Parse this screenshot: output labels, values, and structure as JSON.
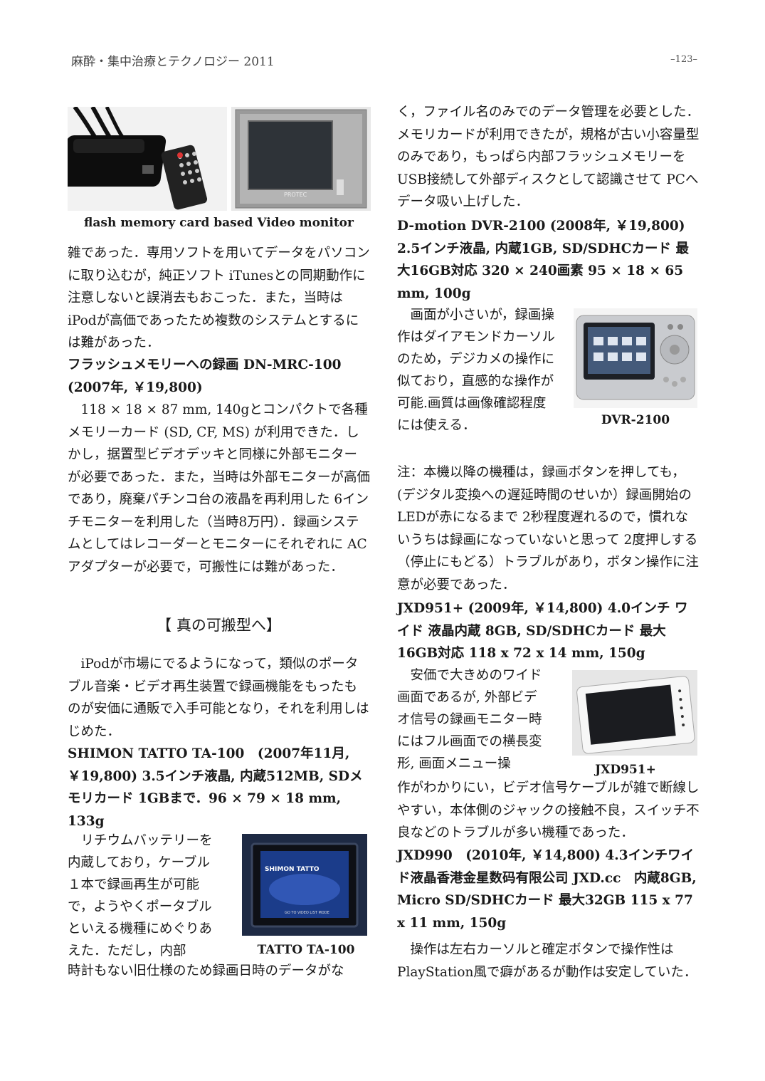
{
  "header": {
    "journal": "麻酔・集中治療とテクノロジー 2011",
    "page": "–123–"
  },
  "left": {
    "fig1_caption": "flash memory card based Video monitor",
    "fig1_label": "PROTEC",
    "p1": "雑であった．専用ソフトを用いてデータをパソコンに取り込むが，純正ソフト iTunesとの同期動作に注意しないと誤消去もおこった．また，当時は iPodが高価であったため複数のシステムとするには難があった．",
    "h_dnmrc": "フラッシュメモリーへの録画 DN-MRC-100 (2007年,  ￥19,800)",
    "p2": "118 × 18 × 87 mm, 140gとコンパクトで各種メモリーカード (SD, CF, MS) が利用できた．しかし，据置型ビデオデッキと同様に外部モニターが必要であった．また，当時は外部モニターが高価であり，廃棄パチンコ台の液晶を再利用した 6インチモニターを利用した（当時8万円）．録画システムとしてはレコーダーとモニターにそれぞれに ACアダプターが必要で，可搬性には難があった．",
    "section": "【 真の可搬型へ】",
    "p3": "iPodが市場にでるようになって，類似のポータブル音楽・ビデオ再生装置で録画機能をもったものが安価に通販で入手可能となり，それを利用しはじめた．",
    "h_tatto": "SHIMON TATTO TA-100　(2007年11月,  ￥19,800) 3.5インチ液晶,  内蔵512MB,  SDメモリカード 1GBまで．96 × 79 × 18 mm, 133g",
    "p4_narrow": "リチウムバッテリーを内蔵しており，ケーブル１本で録画再生が可能で，ようやくポータブルといえる機種にめぐりあえた．ただし，内部",
    "p4_full": "時計もない旧仕様のため録画日時のデータがな",
    "tatto_caption": "TATTO TA-100",
    "tatto_screen_brand": "SHIMON TATTO",
    "tatto_screen_menu": "GO TO VIDEO LIST MODE"
  },
  "right": {
    "p1": "く，ファイル名のみでのデータ管理を必要とした．メモリカードが利用できたが，規格が古い小容量型のみであり，もっぱら内部フラッシュメモリーを USB接続して外部ディスクとして認識させて PCへデータ吸い上げした．",
    "h_dvr": "D-motion DVR-2100 (2008年,  ￥19,800) 2.5インチ液晶,  内蔵1GB,  SD/SDHCカード 最大16GB対応 320 × 240画素 95 × 18 × 65 mm, 100g",
    "p2_narrow": "画面が小さいが，録画操作はダイアモンドカーソルのため，デジカメの操作に似ており，直感的な操作が可能.画質は画像確認程度には使える．",
    "dvr_caption": "DVR-2100",
    "note": "注：本機以降の機種は，録画ボタンを押しても，(デジタル変換への遅延時間のせいか）録画開始の LEDが赤になるまで 2秒程度遅れるので，慣れないうちは録画になっていないと思って 2度押しする（停止にもどる）トラブルがあり，ボタン操作に注意が必要であった．",
    "h_jxd951": "JXD951+ (2009年,  ￥14,800) 4.0インチ ワイド 液晶内蔵 8GB,  SD/SDHCカード 最大16GB対応 118 x 72 x 14 mm, 150g",
    "p3_narrow": "安価で大きめのワイド画面であるが, 外部ビデオ信号の録画モニター時にはフル画面での横長変形, 画面メニュー操",
    "jxd_caption": "JXD951+",
    "p3_full": "作がわかりにい，ビデオ信号ケーブルが雑で断線しやすい，本体側のジャックの接触不良，スイッチ不良などのトラブルが多い機種であった．",
    "h_jxd990": "JXD990　(2010年,  ￥14,800) 4.3インチワイド液晶香港金星数码有限公司 JXD.cc　内蔵8GB,  Micro SD/SDHCカード 最大32GB 115 x 77 x 11 mm, 150g",
    "p4": "操作は左右カーソルと確定ボタンで操作性は PlayStation風で癖があるが動作は安定していた．"
  }
}
